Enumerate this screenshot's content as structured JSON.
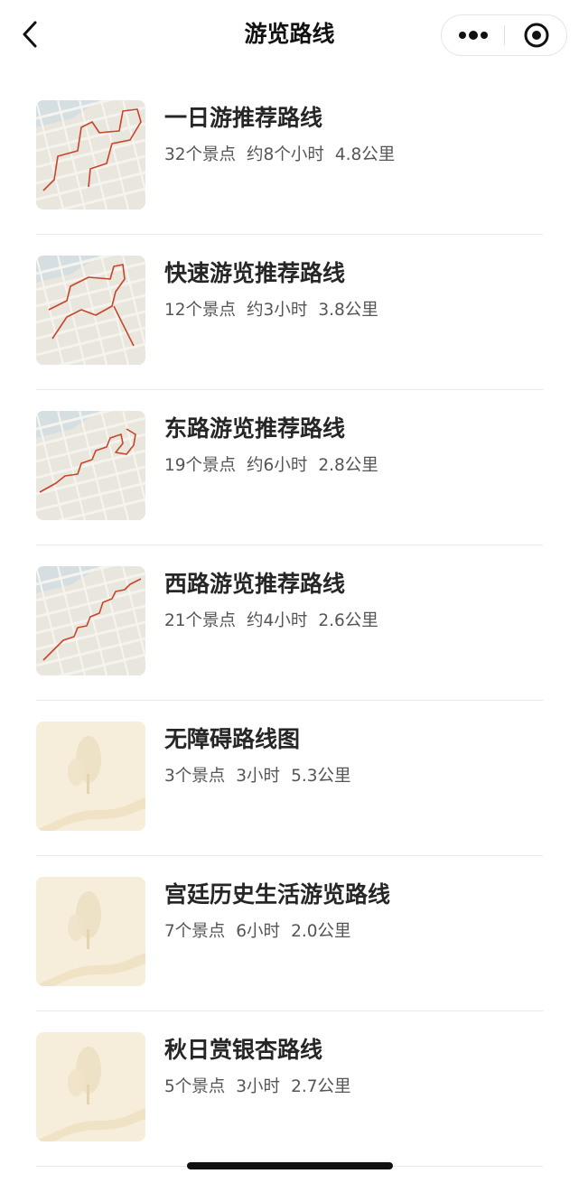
{
  "header": {
    "title": "游览路线",
    "back_icon": "chevron-left-icon",
    "more_icon": "more-dots-icon",
    "close_icon": "target-close-icon"
  },
  "colors": {
    "route_line": "#c8442a",
    "map_bg": "#e9e6dd",
    "illustration_bg": "#f6eedb"
  },
  "routes": [
    {
      "title": "一日游推荐路线",
      "spots": "32个景点",
      "duration": "约8个小时",
      "distance": "4.8公里",
      "thumb": "map-route"
    },
    {
      "title": "快速游览推荐路线",
      "spots": "12个景点",
      "duration": "约3小时",
      "distance": "3.8公里",
      "thumb": "map-route"
    },
    {
      "title": "东路游览推荐路线",
      "spots": "19个景点",
      "duration": "约6小时",
      "distance": "2.8公里",
      "thumb": "map-route"
    },
    {
      "title": "西路游览推荐路线",
      "spots": "21个景点",
      "duration": "约4小时",
      "distance": "2.6公里",
      "thumb": "map-route"
    },
    {
      "title": "无障碍路线图",
      "spots": "3个景点",
      "duration": "3小时",
      "distance": "5.3公里",
      "thumb": "tree-illustration"
    },
    {
      "title": "宫廷历史生活游览路线",
      "spots": "7个景点",
      "duration": "6小时",
      "distance": "2.0公里",
      "thumb": "tree-illustration"
    },
    {
      "title": "秋日赏银杏路线",
      "spots": "5个景点",
      "duration": "3小时",
      "distance": "2.7公里",
      "thumb": "tree-illustration"
    }
  ]
}
